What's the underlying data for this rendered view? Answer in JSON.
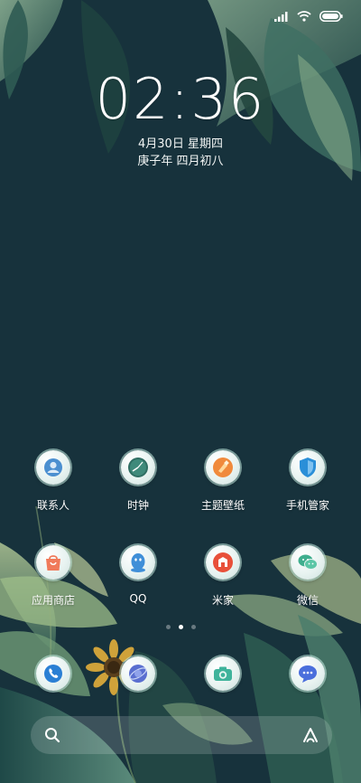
{
  "status_bar": {
    "icons": [
      "signal-icon",
      "wifi-icon",
      "battery-icon"
    ]
  },
  "lock": {
    "time": "02:36",
    "date": "4月30日 星期四",
    "lunar_date": "庚子年 四月初八"
  },
  "apps_row1": [
    {
      "label": "联系人",
      "icon": "contacts-icon"
    },
    {
      "label": "时钟",
      "icon": "clock-icon"
    },
    {
      "label": "主题壁纸",
      "icon": "themes-icon"
    },
    {
      "label": "手机管家",
      "icon": "security-icon"
    }
  ],
  "apps_row2": [
    {
      "label": "应用商店",
      "icon": "app-store-icon"
    },
    {
      "label": "QQ",
      "icon": "qq-icon"
    },
    {
      "label": "米家",
      "icon": "mi-home-icon"
    },
    {
      "label": "微信",
      "icon": "wechat-icon"
    }
  ],
  "dock": [
    {
      "icon": "phone-icon"
    },
    {
      "icon": "browser-icon"
    },
    {
      "icon": "camera-icon"
    },
    {
      "icon": "messages-icon"
    }
  ],
  "pager": {
    "pages": 3,
    "current": 2
  },
  "search_bar": {
    "icons": [
      "search-icon",
      "assistant-icon"
    ]
  },
  "colors": {
    "background": "#17323c",
    "leaf_dark": "#2d5a52",
    "leaf_light": "#a9c6a0",
    "sunflower": "#e2b23c",
    "icon_accent": "#2a8fd8"
  }
}
